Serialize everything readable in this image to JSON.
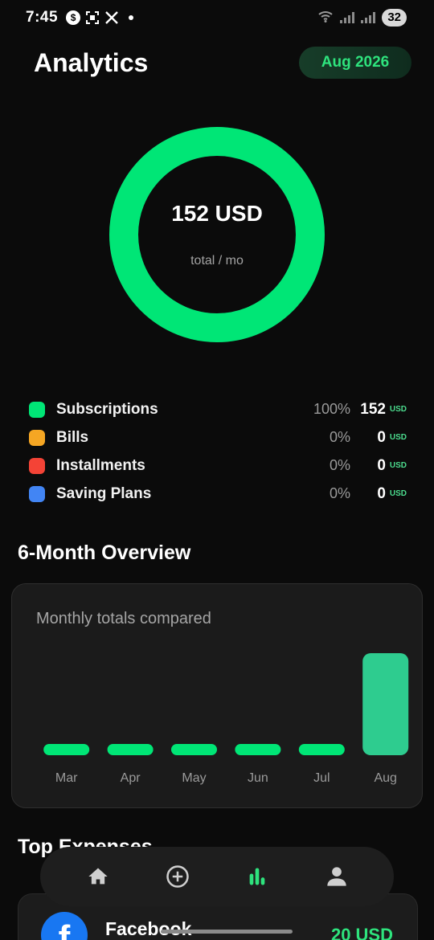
{
  "status_bar": {
    "time": "7:45",
    "battery": "32",
    "left_icons": [
      "s-money-icon",
      "screen-record-icon",
      "x-logo-icon"
    ],
    "right_icons": [
      "wifi-icon",
      "signal-icon",
      "signal-icon"
    ]
  },
  "header": {
    "title": "Analytics",
    "month": "Aug 2026"
  },
  "donut": {
    "value": "152 USD",
    "caption": "total / mo",
    "color": "#00e676",
    "fraction": 1.0
  },
  "legend": [
    {
      "label": "Subscriptions",
      "percent": "100%",
      "amount": "152",
      "currency": "USD",
      "color": "#00e676"
    },
    {
      "label": "Bills",
      "percent": "0%",
      "amount": "0",
      "currency": "USD",
      "color": "#f5a623"
    },
    {
      "label": "Installments",
      "percent": "0%",
      "amount": "0",
      "currency": "USD",
      "color": "#f44336"
    },
    {
      "label": "Saving Plans",
      "percent": "0%",
      "amount": "0",
      "currency": "USD",
      "color": "#4285f4"
    }
  ],
  "overview": {
    "title": "6-Month Overview",
    "caption": "Monthly totals compared"
  },
  "chart_data": {
    "type": "bar",
    "categories": [
      "Mar",
      "Apr",
      "May",
      "Jun",
      "Jul",
      "Aug"
    ],
    "values": [
      0,
      0,
      0,
      0,
      0,
      152
    ],
    "ylim": [
      0,
      152
    ],
    "grid": false,
    "bar_color": "#00e676",
    "highlight_color": "#2ecc8f"
  },
  "top_expenses": {
    "title": "Top Expenses",
    "items": [
      {
        "name": "Facebook",
        "amount": "20 USD",
        "icon": "facebook-icon"
      }
    ]
  },
  "bottom_nav": {
    "items": [
      "home-icon",
      "add-circle-icon",
      "bar-chart-icon",
      "profile-icon"
    ],
    "active": "bar-chart-icon",
    "active_color": "#2ee37d",
    "inactive_color": "#cfcfcf"
  }
}
